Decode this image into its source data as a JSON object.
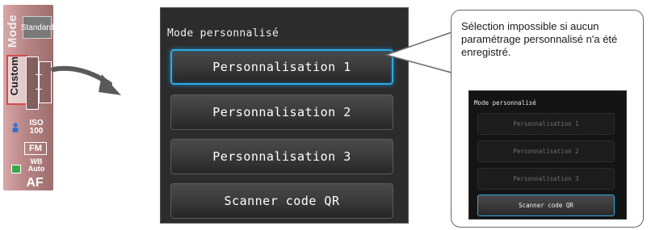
{
  "strip": {
    "mode_label": "Mode",
    "standard_label": "Standard",
    "custom_label": "Custom",
    "iso_label": "ISO",
    "iso_value": "100",
    "fm_label": "FM",
    "wb_label": "WB",
    "wb_value": "Auto",
    "af_label": "AF"
  },
  "screen": {
    "title": "Mode personnalisé",
    "buttons": [
      {
        "label": "Personnalisation 1",
        "selected": true
      },
      {
        "label": "Personnalisation 2",
        "selected": false
      },
      {
        "label": "Personnalisation 3",
        "selected": false
      },
      {
        "label": "Scanner code QR",
        "selected": false
      }
    ]
  },
  "callout": {
    "text": "Sélection impossible si aucun paramétrage personnalisé n'a été enregistré.",
    "mini_title": "Mode personnalisé",
    "mini_buttons": [
      {
        "label": "Personnalisation 1",
        "enabled": false
      },
      {
        "label": "Personnalisation 2",
        "enabled": false
      },
      {
        "label": "Personnalisation 3",
        "enabled": false
      },
      {
        "label": "Scanner code QR",
        "enabled": true
      }
    ]
  },
  "colors": {
    "selection_blue": "#2fa9e0",
    "custom_highlight": "#d64a4a"
  }
}
